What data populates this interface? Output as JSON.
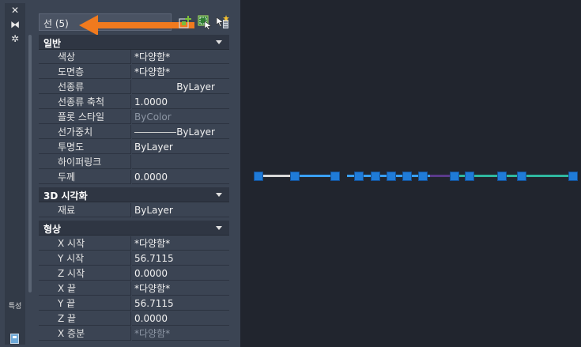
{
  "palette": {
    "strip_icons": [
      "close-icon",
      "autohide-icon",
      "settings-icon"
    ],
    "strip_glyphs": [
      "✕",
      "⧓",
      "✲"
    ],
    "vertical_title": "특성",
    "selection": "선 (5)"
  },
  "sections": [
    {
      "title": "일반",
      "rows": [
        {
          "label": "색상",
          "value": "*다양함*"
        },
        {
          "label": "도면층",
          "value": "*다양함*"
        },
        {
          "label": "선종류",
          "value": "ByLayer"
        },
        {
          "label": "선종류 축척",
          "value": "1.0000"
        },
        {
          "label": "플롯 스타일",
          "value": "ByColor"
        },
        {
          "label": "선가중치",
          "value": "ByLayer"
        },
        {
          "label": "투명도",
          "value": "ByLayer"
        },
        {
          "label": "하이퍼링크",
          "value": ""
        },
        {
          "label": "두께",
          "value": "0.0000"
        }
      ]
    },
    {
      "title": "3D 시각화",
      "rows": [
        {
          "label": "재료",
          "value": "ByLayer"
        }
      ]
    },
    {
      "title": "형상",
      "rows": [
        {
          "label": "X 시작",
          "value": "*다양함*"
        },
        {
          "label": "Y 시작",
          "value": "56.7115"
        },
        {
          "label": "Z 시작",
          "value": "0.0000"
        },
        {
          "label": "X 끝",
          "value": "*다양함*"
        },
        {
          "label": "Y 끝",
          "value": "56.7115"
        },
        {
          "label": "Z 끝",
          "value": "0.0000"
        },
        {
          "label": "X 증분",
          "value": "*다양함*"
        }
      ]
    }
  ],
  "colors": {
    "accent_arrow": "#f07a1e",
    "grip": "#1f7bd8",
    "canvas": "#21252e",
    "line_colors": [
      "#d8d8d8",
      "#3aa0ff",
      "#5a3a8a",
      "#2fb8a0"
    ]
  }
}
